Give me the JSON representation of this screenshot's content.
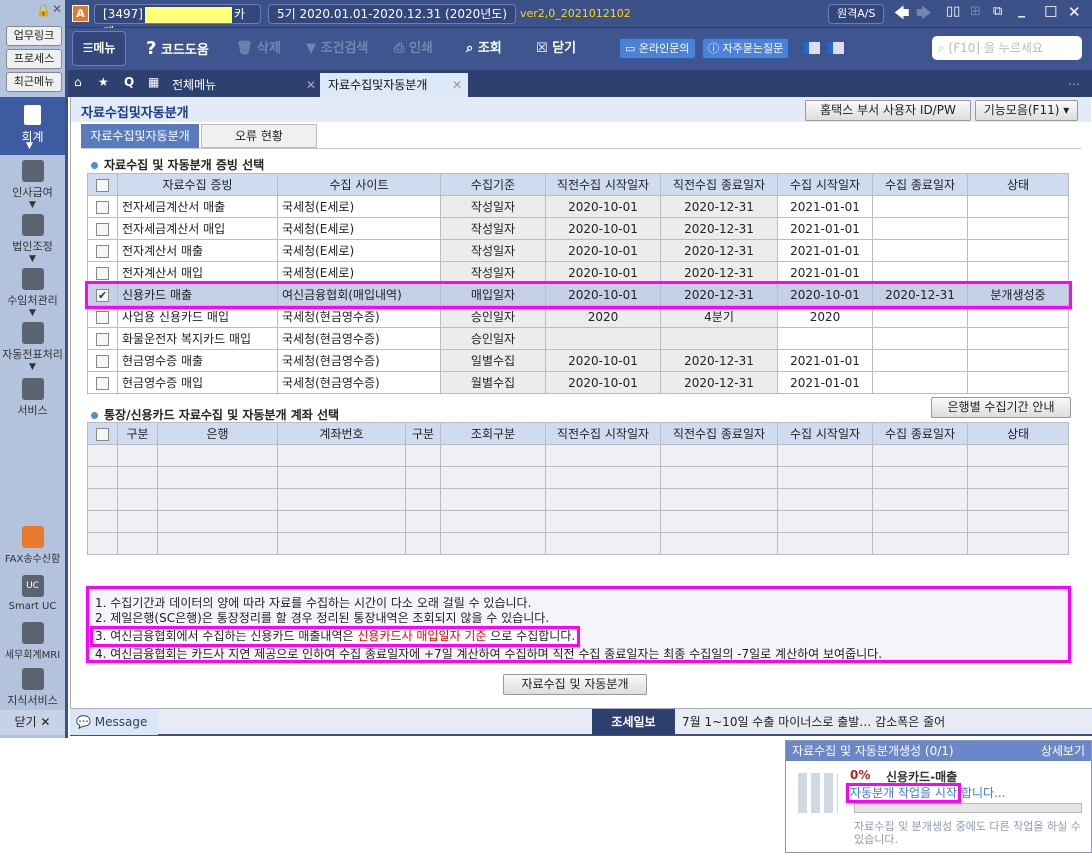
{
  "sidebar": {
    "lock": "🔒",
    "close": "✕",
    "buttons": [
      "업무링크",
      "프로세스",
      "최근메뉴"
    ],
    "nav": [
      "회계",
      "인사급여",
      "법인조정",
      "수임처관리",
      "자동전표처리",
      "서비스"
    ],
    "tools": [
      "FAX송수신함",
      "Smart UC",
      "세무회계MRI",
      "지식서비스"
    ],
    "close_label": "닫기"
  },
  "topbar": {
    "company_code": "[3497]",
    "company_suffix": "카페",
    "period": "5기  2020.01.01-2020.12.31  (2020년도)",
    "version": "ver2,0_2021012102",
    "remote_as": "원격A/S"
  },
  "toolbar": {
    "menu": "메뉴",
    "code_help": "코드도움",
    "delete": "삭제",
    "condition_search": "조건검색",
    "print": "인쇄",
    "search": "조회",
    "close": "닫기",
    "online_inquiry": "온라인문의",
    "faq": "자주묻는질문",
    "search_placeholder": "[F10] 을 누르세요"
  },
  "tabs": [
    "전체메뉴",
    "자료수집및자동분개"
  ],
  "page": {
    "title": "자료수집및자동분개",
    "hometax_btn": "홈택스 부서 사용자 ID/PW",
    "functions_btn": "기능모음(F11)",
    "subtabs": [
      "자료수집및자동분개",
      "오류 현황"
    ]
  },
  "section1": {
    "title": "자료수집 및 자동분개 증빙 선택",
    "headers": [
      "자료수집 증빙",
      "수집 사이트",
      "수집기준",
      "직전수집 시작일자",
      "직전수집 종료일자",
      "수집 시작일자",
      "수집 종료일자",
      "상태"
    ],
    "rows": [
      {
        "checked": false,
        "cells": [
          "전자세금계산서 매출",
          "국세청(E세로)",
          "작성일자",
          "2020-10-01",
          "2020-12-31",
          "2021-01-01",
          "",
          ""
        ]
      },
      {
        "checked": false,
        "cells": [
          "전자세금계산서 매입",
          "국세청(E세로)",
          "작성일자",
          "2020-10-01",
          "2020-12-31",
          "2021-01-01",
          "",
          ""
        ]
      },
      {
        "checked": false,
        "cells": [
          "전자계산서 매출",
          "국세청(E세로)",
          "작성일자",
          "2020-10-01",
          "2020-12-31",
          "2021-01-01",
          "",
          ""
        ]
      },
      {
        "checked": false,
        "cells": [
          "전자계산서 매입",
          "국세청(E세로)",
          "작성일자",
          "2020-10-01",
          "2020-12-31",
          "2021-01-01",
          "",
          ""
        ]
      },
      {
        "checked": true,
        "cells": [
          "신용카드 매출",
          "여신금융협회(매입내역)",
          "매입일자",
          "2020-10-01",
          "2020-12-31",
          "2020-10-01",
          "2020-12-31",
          "분개생성중"
        ]
      },
      {
        "checked": false,
        "cells": [
          "사업용 신용카드 매입",
          "국세청(현금영수증)",
          "승인일자",
          "2020",
          "4분기",
          "2020",
          "",
          ""
        ]
      },
      {
        "checked": false,
        "cells": [
          "화물운전자 복지카드 매입",
          "국세청(현금영수증)",
          "승인일자",
          "",
          "",
          "",
          "",
          ""
        ]
      },
      {
        "checked": false,
        "cells": [
          "현금영수증 매출",
          "국세청(현금영수증)",
          "일별수집",
          "2020-10-01",
          "2020-12-31",
          "2021-01-01",
          "",
          ""
        ]
      },
      {
        "checked": false,
        "cells": [
          "현금영수증 매입",
          "국세청(현금영수증)",
          "월별수집",
          "2020-10-01",
          "2020-12-31",
          "2021-01-01",
          "",
          ""
        ]
      }
    ]
  },
  "section2": {
    "title": "통장/신용카드 자료수집 및 자동분개 계좌 선택",
    "bank_period_btn": "은행별 수집기간 안내",
    "headers": [
      "구분",
      "은행",
      "계좌번호",
      "구분",
      "조회구분",
      "직전수집 시작일자",
      "직전수집 종료일자",
      "수집 시작일자",
      "수집 종료일자",
      "상태"
    ]
  },
  "notes": {
    "line1": "1. 수집기간과 데이터의 양에 따라 자료를 수집하는 시간이 다소 오래 걸릴 수 있습니다.",
    "line2": "2. 제일은행(SC은행)은 통장정리를 할 경우 정리된 통장내역은 조회되지 않을 수 있습니다.",
    "line3_a": "3. 여신금융협회에서 수집하는 신용카드 매출내역은 ",
    "line3_red": "신용카드사 매입일자 기준",
    "line3_b": " 으로 수집합니다.",
    "line4": "4. 여신금융협회는 카드사 지연 제공으로 인하여 수집 종료일자에 +7일 계산하여 수집하며 직전 수집 종료일자는 최종 수집일의 -7일로 계산하여 보여줍니다."
  },
  "run_btn": "자료수집 및 자동분개",
  "statusbar": {
    "message": "Message",
    "news_label": "조세일보",
    "news": "7월 1~10일 수출 마이너스로 출발… 감소폭은 줄어"
  },
  "popup": {
    "title": "자료수집 및 자동분개생성 (0/1)",
    "detail": "상세보기",
    "percent": "0%",
    "item": "신용카드-매출",
    "status_a": "자동분개 작업을 시작",
    "status_b": "합니다...",
    "progress": 0,
    "note": "자료수집 및 분개생성 중에도 다른 작업을 하실 수 있습니다."
  }
}
